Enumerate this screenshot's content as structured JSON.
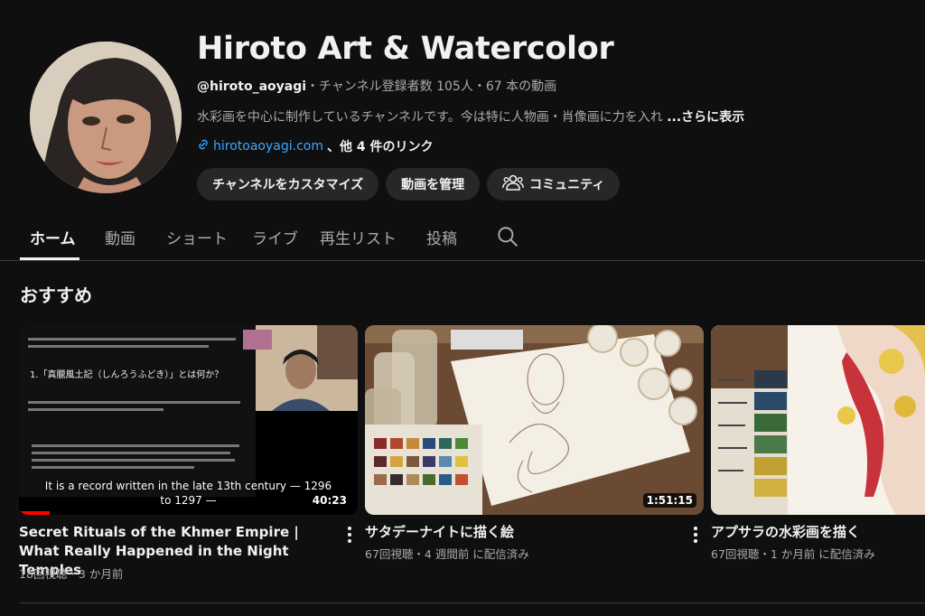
{
  "channel": {
    "name": "Hiroto Art & Watercolor",
    "handle": "@hiroto_aoyagi",
    "stats": "・チャンネル登録者数 105人・67 本の動画",
    "description": "水彩画を中心に制作しているチャンネルです。今は特に人物画・肖像画に力を入れ",
    "more_label": "...さらに表示",
    "link_url": "hirotoaoyagi.com",
    "link_more": "、他 4 件のリンク"
  },
  "buttons": {
    "customize": "チャンネルをカスタマイズ",
    "manage": "動画を管理",
    "community": "コミュニティ"
  },
  "tabs": [
    "ホーム",
    "動画",
    "ショート",
    "ライブ",
    "再生リスト",
    "投稿"
  ],
  "section": {
    "title": "おすすめ"
  },
  "videos": [
    {
      "title": "Secret Rituals of the Khmer Empire | What Really Happened in the Night Temples",
      "meta": "18回視聴・3 か月前",
      "duration": "40:23",
      "caption1": "It is a record written in the late 13th century — 1296",
      "caption2": "to 1297 —",
      "slide_heading": "1.「真臘風土記（しんろうふどき）」とは何か？",
      "progress": 0.09
    },
    {
      "title": "サタデーナイトに描く絵",
      "meta": "67回視聴・4 週間前 に配信済み",
      "duration": "1:51:15"
    },
    {
      "title": "アプサラの水彩画を描く",
      "meta": "67回視聴・1 か月前 に配信済み"
    }
  ],
  "colors": {
    "background": "#0f0f0f",
    "link": "#3ea6ff",
    "progress": "#ff0000"
  }
}
